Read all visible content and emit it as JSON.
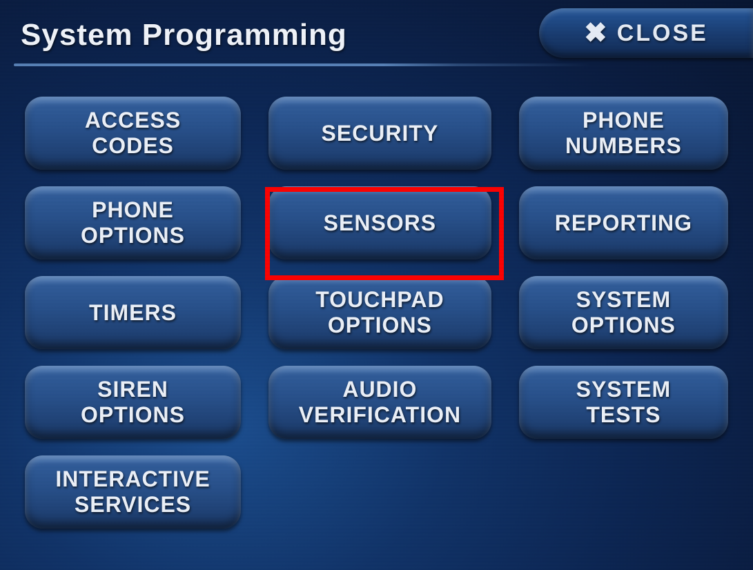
{
  "header": {
    "title": "System Programming",
    "close_label": "CLOSE"
  },
  "columns": [
    [
      "ACCESS\nCODES",
      "PHONE\nOPTIONS",
      "TIMERS",
      "SIREN\nOPTIONS",
      "INTERACTIVE\nSERVICES"
    ],
    [
      "SECURITY",
      "SENSORS",
      "TOUCHPAD\nOPTIONS",
      "AUDIO\nVERIFICATION"
    ],
    [
      "PHONE\nNUMBERS",
      "REPORTING",
      "SYSTEM\nOPTIONS",
      "SYSTEM\nTESTS"
    ]
  ],
  "highlighted": "SENSORS"
}
